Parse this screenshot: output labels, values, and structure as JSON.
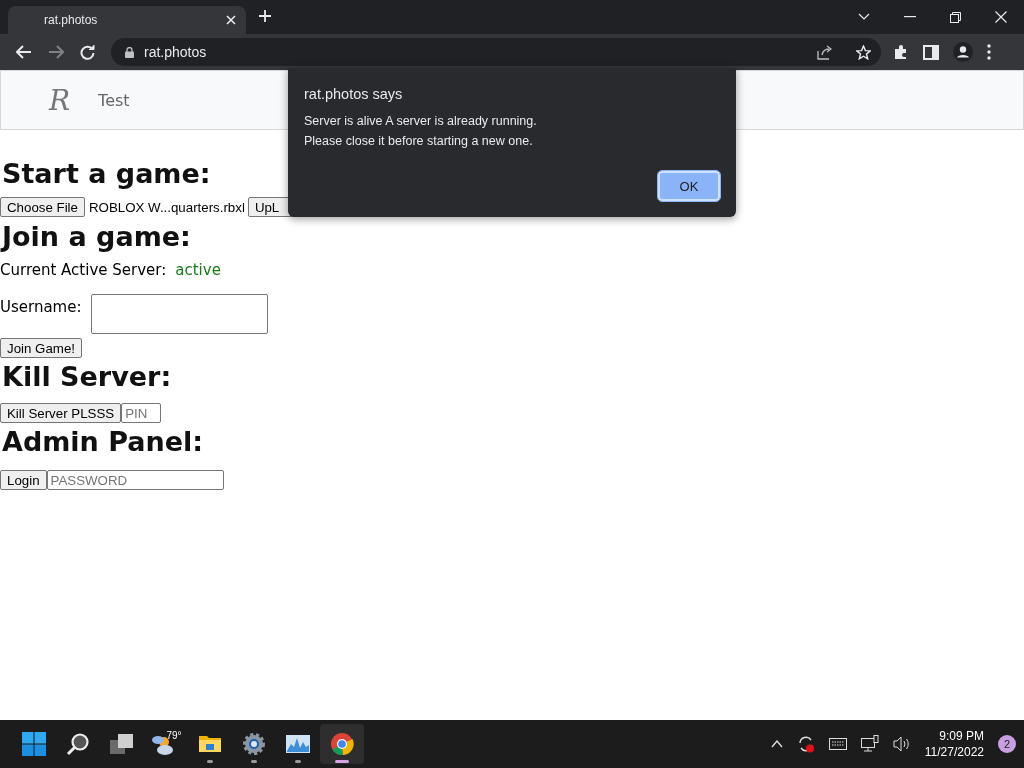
{
  "browser": {
    "tab_title": "rat.photos",
    "address": "rat.photos"
  },
  "site_header": {
    "logo": "R",
    "title": "Test"
  },
  "start_game": {
    "heading": "Start a game:",
    "choose_button": "Choose File",
    "file_name": "ROBLOX W...quarters.rbxl",
    "upload_button": "UpL"
  },
  "join_game": {
    "heading": "Join a game:",
    "status_label": "Current Active Server:",
    "status_value": "active",
    "username_label": "Username:",
    "join_button": "Join Game!"
  },
  "kill_server": {
    "heading": "Kill Server:",
    "button": "Kill Server PLSSS",
    "pin_placeholder": "PIN"
  },
  "admin_panel": {
    "heading": "Admin Panel:",
    "button": "Login",
    "password_placeholder": "PASSWORD"
  },
  "dialog": {
    "title": "rat.photos says",
    "message_lines": [
      "Server is alive A server is already running.",
      "Please close it before starting a new one."
    ],
    "ok_button": "OK"
  },
  "taskbar": {
    "weather_temp": "79°",
    "apps": [
      {
        "kind": "explorer",
        "running": true,
        "selected": false
      },
      {
        "kind": "settings",
        "running": true,
        "selected": false
      },
      {
        "kind": "monitor",
        "running": true,
        "selected": false
      },
      {
        "kind": "chrome",
        "running": true,
        "selected": true
      }
    ],
    "time": "9:09 PM",
    "date": "11/27/2022",
    "notification_count": "2"
  }
}
